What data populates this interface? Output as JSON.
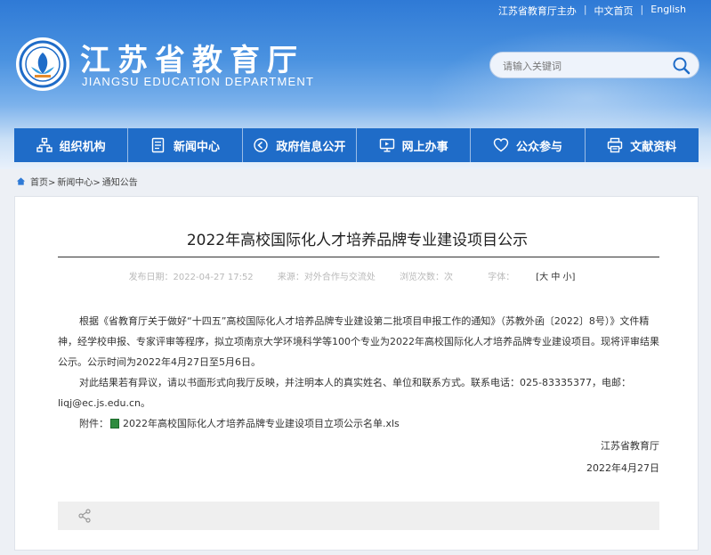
{
  "top_links": [
    "江苏省教育厅主办",
    "中文首页",
    "English"
  ],
  "site": {
    "title": "江苏省教育厅",
    "subtitle": "JIANGSU EDUCATION DEPARTMENT",
    "search_placeholder": "请输入关键词"
  },
  "nav": [
    {
      "label": "组织机构",
      "icon": "org-chart-icon"
    },
    {
      "label": "新闻中心",
      "icon": "news-icon"
    },
    {
      "label": "政府信息公开",
      "icon": "info-disclosure-icon"
    },
    {
      "label": "网上办事",
      "icon": "monitor-icon"
    },
    {
      "label": "公众参与",
      "icon": "heart-icon"
    },
    {
      "label": "文献资料",
      "icon": "printer-icon"
    }
  ],
  "breadcrumb": [
    "首页>",
    "新闻中心>",
    "通知公告"
  ],
  "article": {
    "title": "2022年高校国际化人才培养品牌专业建设项目公示",
    "meta_date": "发布日期：2022-04-27 17:52",
    "meta_source": "来源：对外合作与交流处",
    "meta_views": "浏览次数：次",
    "meta_fontsize_label": "字体：",
    "meta_fontsize_sizes": "[大 中 小]",
    "paragraph1": "根据《省教育厅关于做好“十四五”高校国际化人才培养品牌专业建设第二批项目申报工作的通知》（苏教外函〔2022〕8号）》文件精神，经学校申报、专家评审等程序，拟立项南京大学环境科学等100个专业为2022年高校国际化人才培养品牌专业建设项目。现将评审结果公示。公示时间为2022年4月27日至5月6日。",
    "paragraph2": "对此结果若有异议，请以书面形式向我厅反映，并注明本人的真实姓名、单位和联系方式。联系电话：025-83335377，电邮：liqj@ec.js.edu.cn。",
    "attachment_label": "附件：",
    "attachment_name": "2022年高校国际化人才培养品牌专业建设项目立项公示名单.xls",
    "signature": "江苏省教育厅",
    "sign_date": "2022年4月27日"
  },
  "colors": {
    "nav_bg": "#1f6cc8",
    "header_top": "#2f7ad6",
    "page_bg": "#edf0f5"
  }
}
